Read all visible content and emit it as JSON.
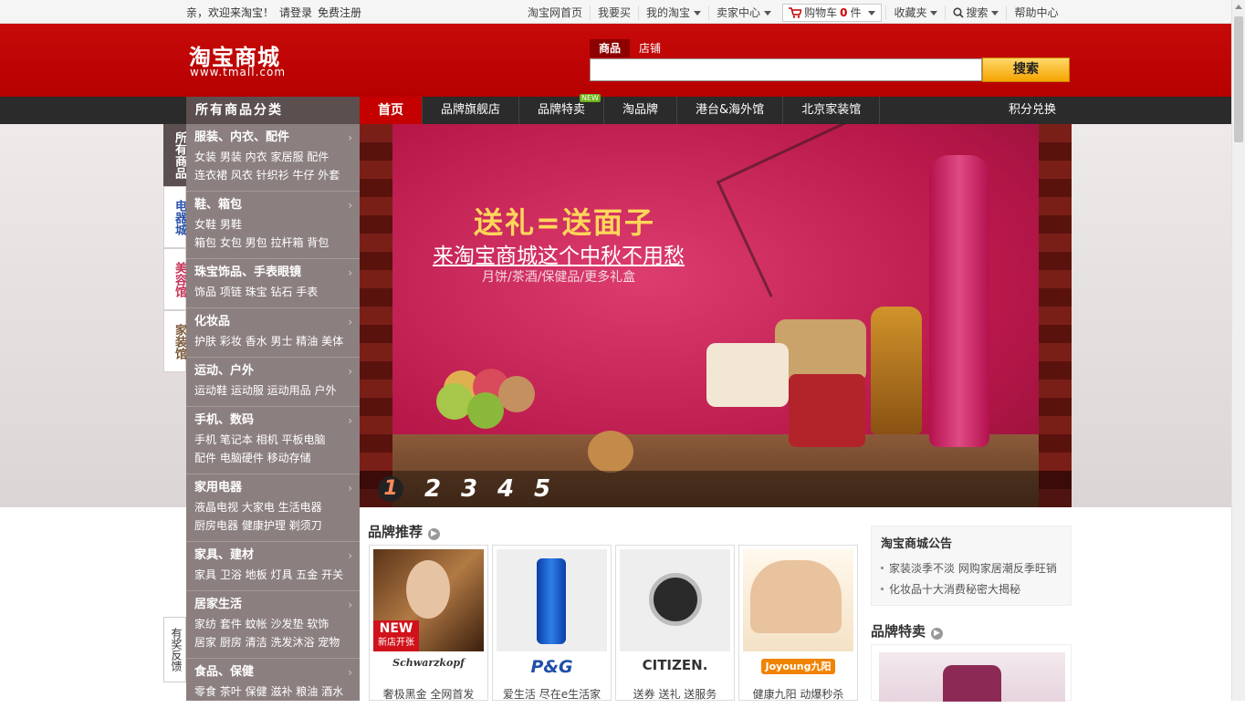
{
  "topbar": {
    "greeting": "亲，欢迎来淘宝！",
    "login": "请登录",
    "register": "免费注册",
    "links": [
      "淘宝网首页",
      "我要买",
      "我的淘宝",
      "卖家中心",
      "购物车",
      "收藏夹",
      "搜索",
      "帮助中心"
    ],
    "cart_count": "0",
    "cart_unit": "件"
  },
  "header": {
    "logo_cn": "淘宝商城",
    "logo_en": "www.tmall.com",
    "search_tabs": [
      "商品",
      "店铺"
    ],
    "search_value": "",
    "search_button": "搜索"
  },
  "nav": {
    "category_title": "所有商品分类",
    "items": [
      "首页",
      "品牌旗舰店",
      "品牌特卖",
      "淘品牌",
      "港台&海外馆",
      "北京家装馆"
    ],
    "new_badge": "NEW",
    "right": "积分兑换"
  },
  "side_tabs": [
    "所有商品",
    "电器城",
    "美容馆",
    "家装馆"
  ],
  "feedback": "有奖反馈",
  "categories": [
    {
      "name": "服装、内衣、配件",
      "line1": "女装 男装 内衣 家居服 配件",
      "line2": "连衣裙 风衣 针织衫 牛仔 外套"
    },
    {
      "name": "鞋、箱包",
      "line1": "女鞋 男鞋",
      "line2": "箱包 女包 男包 拉杆箱 背包"
    },
    {
      "name": "珠宝饰品、手表眼镜",
      "line1": "饰品 项链 珠宝 钻石 手表",
      "line2": ""
    },
    {
      "name": "化妆品",
      "line1": "护肤 彩妆 香水 男士 精油 美体",
      "line2": ""
    },
    {
      "name": "运动、户外",
      "line1": "运动鞋 运动服 运动用品 户外",
      "line2": ""
    },
    {
      "name": "手机、数码",
      "line1": "手机 笔记本 相机 平板电脑",
      "line2": "配件 电脑硬件 移动存储"
    },
    {
      "name": "家用电器",
      "line1": "液晶电视 大家电 生活电器",
      "line2": "厨房电器 健康护理 剃须刀"
    },
    {
      "name": "家具、建材",
      "line1": "家具 卫浴 地板 灯具 五金 开关",
      "line2": ""
    },
    {
      "name": "居家生活",
      "line1": "家纺 套件 蚊帐 沙发垫 软饰",
      "line2": "居家 厨房 清洁 洗发沐浴 宠物"
    },
    {
      "name": "食品、保健",
      "line1": "零食 茶叶 保健 滋补 粮油 酒水",
      "line2": ""
    }
  ],
  "banner": {
    "headline": "送礼=送面子",
    "subline": "来淘宝商城这个中秋不用愁",
    "tagline": "月饼/茶酒/保健品/更多礼盒",
    "slides": [
      "1",
      "2",
      "3",
      "4",
      "5"
    ]
  },
  "brands": {
    "title": "品牌推荐",
    "cards": [
      {
        "logo": "Schwarzkopf",
        "badge": "NEW",
        "badge_sub": "新店开张",
        "desc": "奢极黑金 全网首发"
      },
      {
        "logo": "P&G",
        "desc": "爱生活 尽在e生活家"
      },
      {
        "logo": "CITIZEN.",
        "desc": "送券 送礼 送服务"
      },
      {
        "logo": "Joyoung九阳",
        "desc": "健康九阳 动爆秒杀"
      }
    ]
  },
  "notice": {
    "title": "淘宝商城公告",
    "items": [
      "家装淡季不淡 网购家居潮反季旺销",
      "化妆品十大消费秘密大揭秘"
    ]
  },
  "special": {
    "title": "品牌特卖"
  },
  "colors": {
    "brand_red": "#c40000",
    "nav_dark": "#2b2b2b",
    "category_bg": "#8c7f7f",
    "search_button": "#f5a400"
  }
}
